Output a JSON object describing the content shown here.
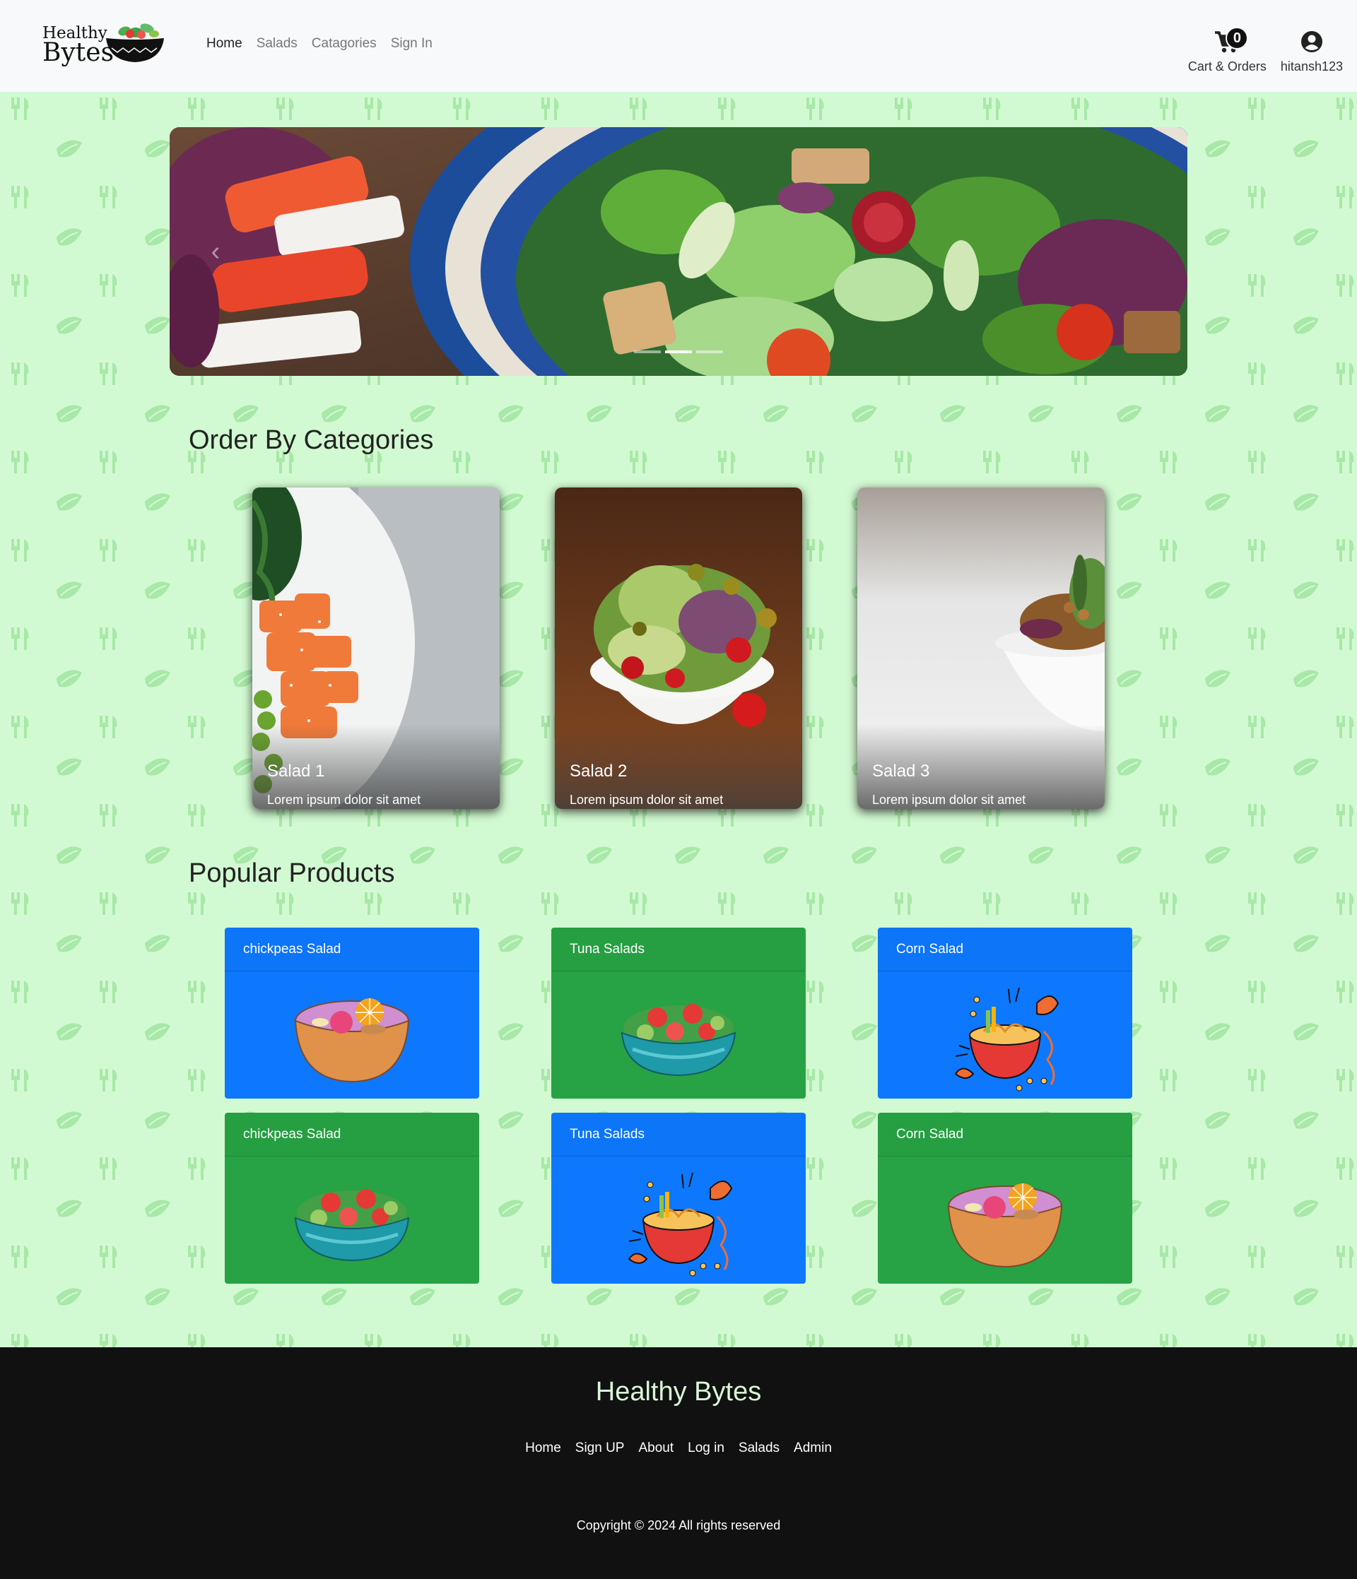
{
  "brand": {
    "line1": "Healthy",
    "line2": "Bytes"
  },
  "nav": {
    "links": [
      {
        "label": "Home",
        "active": true
      },
      {
        "label": "Salads",
        "active": false
      },
      {
        "label": "Catagories",
        "active": false
      },
      {
        "label": "Sign In",
        "active": false
      }
    ],
    "cart": {
      "count": "0",
      "label": "Cart & Orders"
    },
    "user": {
      "label": "hitansh123"
    }
  },
  "carousel": {
    "slides": 3,
    "active_slide": 2
  },
  "categories": {
    "title": "Order By Categories",
    "items": [
      {
        "title": "Salad 1",
        "text": "Lorem ipsum dolor sit amet"
      },
      {
        "title": "Salad 2",
        "text": "Lorem ipsum dolor sit amet"
      },
      {
        "title": "Salad 3",
        "text": "Lorem ipsum dolor sit amet"
      }
    ]
  },
  "popular": {
    "title": "Popular Products",
    "items": [
      {
        "name": "chickpeas Salad",
        "color": "#0d78fd",
        "image": "fruit-bowl"
      },
      {
        "name": "Tuna Salads",
        "color": "#27a244",
        "image": "salad-bowl"
      },
      {
        "name": "Corn Salad",
        "color": "#0d78fd",
        "image": "noodle-bowl"
      },
      {
        "name": "chickpeas Salad",
        "color": "#27a244",
        "image": "salad-bowl"
      },
      {
        "name": "Tuna Salads",
        "color": "#0d78fd",
        "image": "noodle-bowl"
      },
      {
        "name": "Corn Salad",
        "color": "#27a244",
        "image": "fruit-bowl"
      }
    ]
  },
  "footer": {
    "brand": "Healthy Bytes",
    "links": [
      "Home",
      "Sign UP",
      "About",
      "Log in",
      "Salads",
      "Admin"
    ],
    "copyright": "Copyright © 2024 All rights reserved"
  },
  "colors": {
    "background": "#d2fad2",
    "pattern": "#a8e8a8",
    "card_blue": "#0d78fd",
    "card_green": "#27a244",
    "footer": "#111111",
    "footer_brand": "#d9f7d6"
  }
}
